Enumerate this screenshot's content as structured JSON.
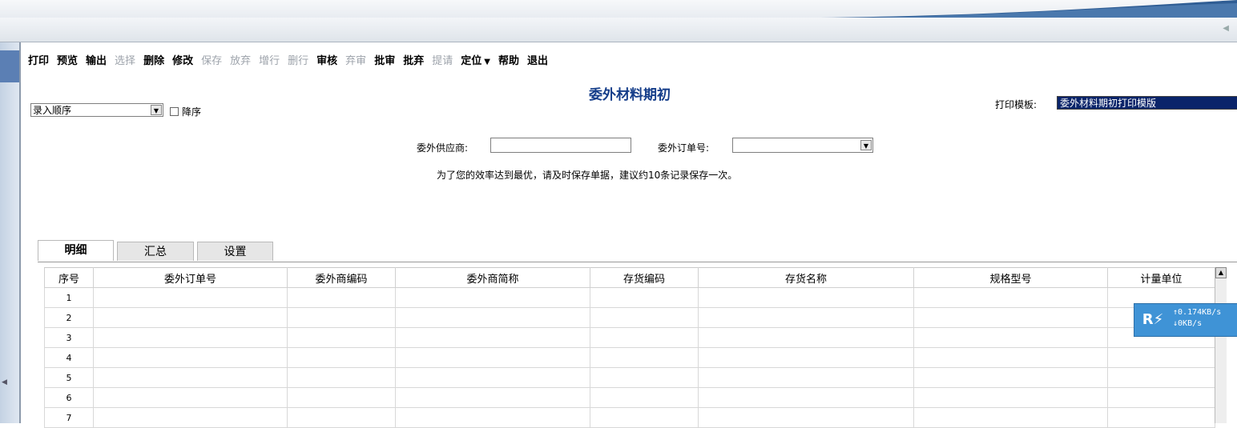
{
  "toolbar": [
    {
      "label": "打印",
      "enabled": true
    },
    {
      "label": "预览",
      "enabled": true
    },
    {
      "label": "输出",
      "enabled": true
    },
    {
      "label": "选择",
      "enabled": false
    },
    {
      "label": "删除",
      "enabled": true
    },
    {
      "label": "修改",
      "enabled": true
    },
    {
      "label": "保存",
      "enabled": false
    },
    {
      "label": "放弃",
      "enabled": false
    },
    {
      "label": "增行",
      "enabled": false
    },
    {
      "label": "删行",
      "enabled": false
    },
    {
      "label": "审核",
      "enabled": true
    },
    {
      "label": "弃审",
      "enabled": false
    },
    {
      "label": "批审",
      "enabled": true
    },
    {
      "label": "批弃",
      "enabled": true
    },
    {
      "label": "提请",
      "enabled": false
    },
    {
      "label": "定位",
      "enabled": true,
      "dropdown": true
    },
    {
      "label": "帮助",
      "enabled": true
    },
    {
      "label": "退出",
      "enabled": true
    }
  ],
  "title": "委外材料期初",
  "sort": {
    "value": "录入顺序",
    "desc_label": "降序"
  },
  "print_template": {
    "label": "打印模板:",
    "value": "委外材料期初打印模版"
  },
  "filters": {
    "supplier_label": "委外供应商:",
    "order_label": "委外订单号:"
  },
  "notice": "为了您的效率达到最优，请及时保存单据，建议约10条记录保存一次。",
  "tabs": [
    "明细",
    "汇总",
    "设置"
  ],
  "grid": {
    "columns": [
      "序号",
      "委外订单号",
      "委外商编码",
      "委外商简称",
      "存货编码",
      "存货名称",
      "规格型号",
      "计量单位"
    ],
    "rows": [
      "1",
      "2",
      "3",
      "4",
      "5",
      "6",
      "7"
    ]
  },
  "net_widget": {
    "up": "0.174KB/s",
    "down": "0KB/s"
  },
  "colors": {
    "title": "#163e8a",
    "selected_template_bg": "#0a246a",
    "net_widget": "#3f93d6"
  }
}
